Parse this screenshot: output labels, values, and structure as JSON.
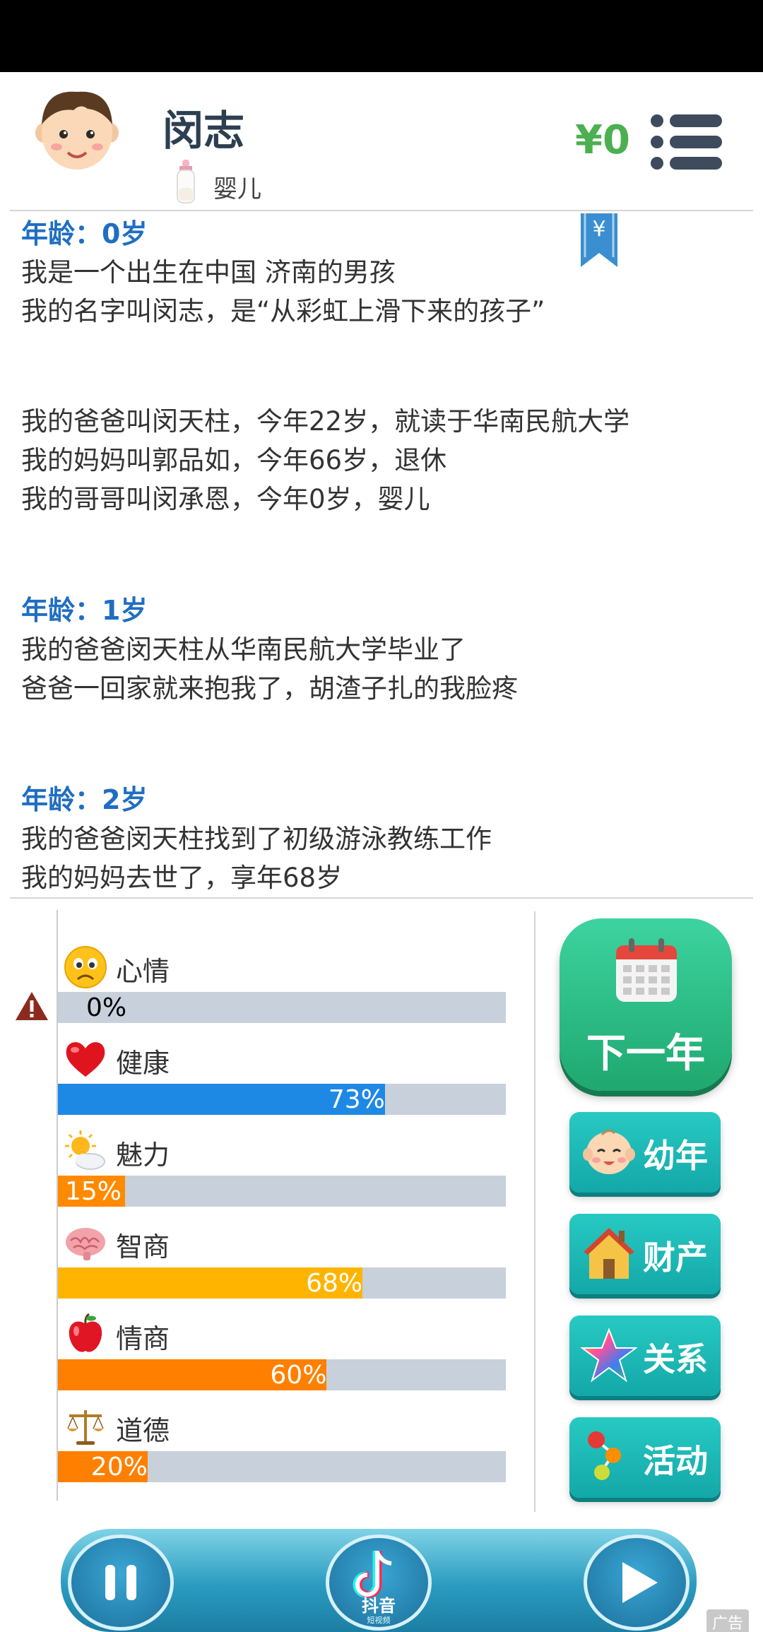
{
  "header": {
    "name": "闵志",
    "stage": "婴儿",
    "money": "¥0",
    "avatar_icon": "baby-boy-face",
    "bottle_icon": "baby-bottle",
    "menu_icon": "list-menu"
  },
  "bookmark": {
    "symbol": "¥",
    "color": "#3b8ecf"
  },
  "log": [
    {
      "age": "年龄：0岁",
      "lines": [
        "我是一个出生在中国 济南的男孩",
        "我的名字叫闵志，是“从彩虹上滑下来的孩子”",
        "",
        "",
        "我的爸爸叫闵天柱，今年22岁，就读于华南民航大学",
        "我的妈妈叫郭品如，今年66岁，退休",
        "我的哥哥叫闵承恩，今年0岁，婴儿"
      ]
    },
    {
      "age": "年龄：1岁",
      "lines": [
        "我的爸爸闵天柱从华南民航大学毕业了",
        "爸爸一回家就来抱我了，胡渣子扎的我脸疼"
      ]
    },
    {
      "age": "年龄：2岁",
      "lines": [
        "我的爸爸闵天柱找到了初级游泳教练工作",
        "我的妈妈去世了，享年68岁"
      ]
    }
  ],
  "stats": [
    {
      "label": "心情",
      "value": 0,
      "text": "0%",
      "color": "#1e88e5",
      "icon": "sad-face"
    },
    {
      "label": "健康",
      "value": 73,
      "text": "73%",
      "color": "#1e88e5",
      "icon": "heart"
    },
    {
      "label": "魅力",
      "value": 15,
      "text": "15%",
      "color": "#ff8a00",
      "icon": "sun-cloud"
    },
    {
      "label": "智商",
      "value": 68,
      "text": "68%",
      "color": "#ffb400",
      "icon": "brain"
    },
    {
      "label": "情商",
      "value": 60,
      "text": "60%",
      "color": "#ff8000",
      "icon": "apple"
    },
    {
      "label": "道德",
      "value": 20,
      "text": "20%",
      "color": "#ff8000",
      "icon": "scales"
    }
  ],
  "actions": {
    "next_year": "下一年",
    "buttons": [
      {
        "label": "幼年",
        "icon": "baby-face"
      },
      {
        "label": "财产",
        "icon": "house"
      },
      {
        "label": "关系",
        "icon": "star"
      },
      {
        "label": "活动",
        "icon": "dots"
      }
    ]
  },
  "ad": {
    "brand": "抖音",
    "sub": "短视频",
    "label": "广告"
  }
}
